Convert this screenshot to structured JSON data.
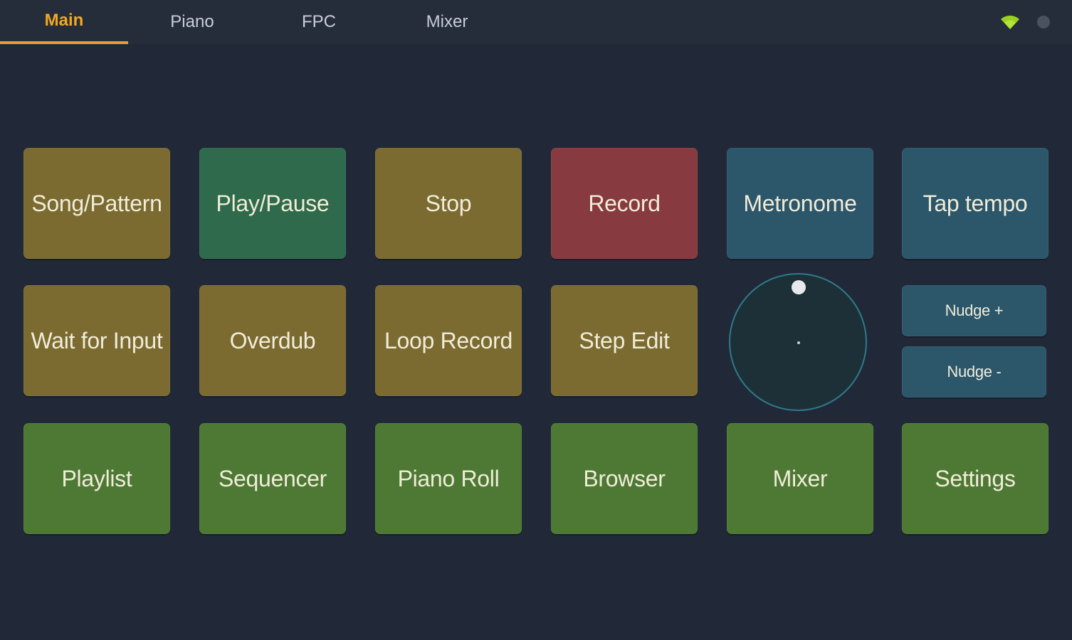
{
  "tabs": [
    {
      "label": "Main",
      "active": true
    },
    {
      "label": "Piano",
      "active": false
    },
    {
      "label": "FPC",
      "active": false
    },
    {
      "label": "Mixer",
      "active": false
    }
  ],
  "status": {
    "icons": [
      "wifi-icon",
      "connection-dot-icon"
    ],
    "wifi_color": "#9bd11e"
  },
  "colors": {
    "accent": "#f2a81e",
    "pad_olive": "#7a6a30",
    "pad_teal_green": "#2e6b4c",
    "pad_red": "#8a3a3f",
    "pad_blue": "#2b566b",
    "pad_green": "#4e7a34",
    "background": "#212938"
  },
  "pads": {
    "row1": [
      {
        "label": "Song/Pattern",
        "color": "#7b6b31"
      },
      {
        "label": "Play/Pause",
        "color": "#2e6a4b"
      },
      {
        "label": "Stop",
        "color": "#7b6b31"
      },
      {
        "label": "Record",
        "color": "#873b40"
      },
      {
        "label": "Metronome",
        "color": "#2c566a"
      },
      {
        "label": "Tap tempo",
        "color": "#2c566a"
      }
    ],
    "row2": [
      {
        "label": "Wait for Input",
        "color": "#7b6b31"
      },
      {
        "label": "Overdub",
        "color": "#7b6b31"
      },
      {
        "label": "Loop Record",
        "color": "#7b6b31"
      },
      {
        "label": "Step Edit",
        "color": "#7b6b31"
      }
    ],
    "nudge": [
      {
        "label": "Nudge +",
        "color": "#2c566a"
      },
      {
        "label": "Nudge -",
        "color": "#2c566a"
      }
    ],
    "row3": [
      {
        "label": "Playlist",
        "color": "#4d7934"
      },
      {
        "label": "Sequencer",
        "color": "#4d7934"
      },
      {
        "label": "Piano Roll",
        "color": "#4d7934"
      },
      {
        "label": "Browser",
        "color": "#4d7934"
      },
      {
        "label": "Mixer",
        "color": "#4d7934"
      },
      {
        "label": "Settings",
        "color": "#4d7934"
      }
    ]
  },
  "jog": {
    "label": "jog-wheel"
  }
}
